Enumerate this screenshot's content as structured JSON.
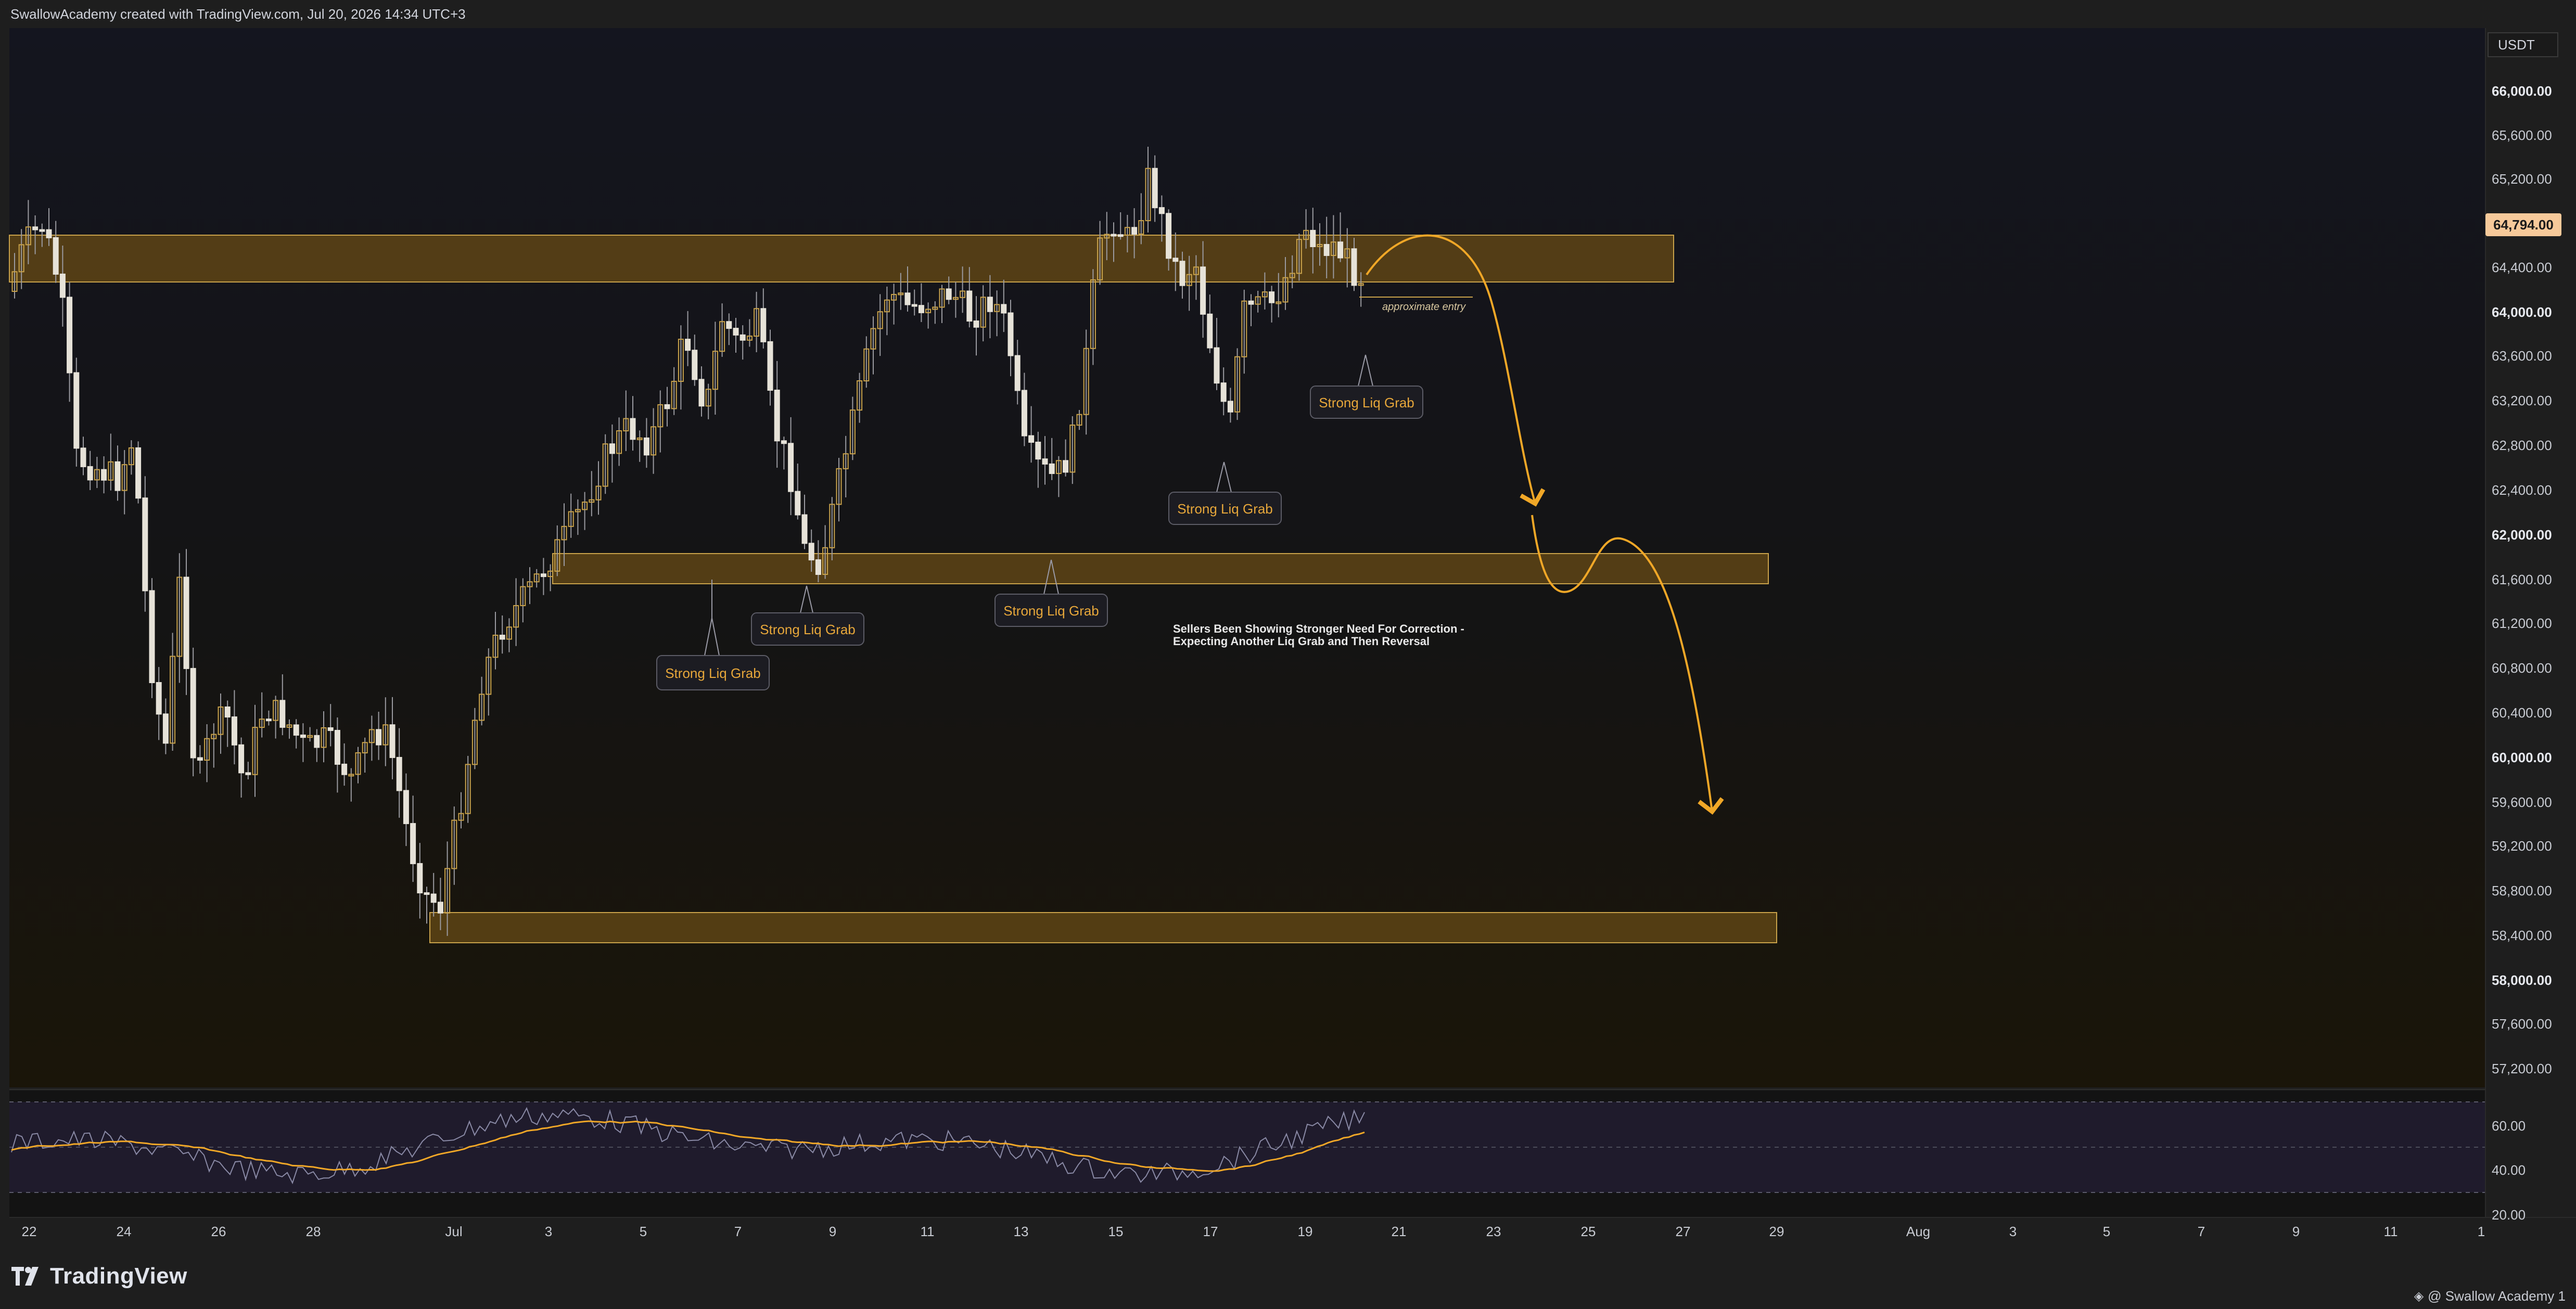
{
  "header": {
    "text": "SwallowAcademy created with TradingView.com, Jul 20, 2026 14:34 UTC+3"
  },
  "price_axis": {
    "currency": "USDT",
    "labels": [
      "66,000.00",
      "65,600.00",
      "65,200.00",
      "64,400.00",
      "64,000.00",
      "63,600.00",
      "63,200.00",
      "62,800.00",
      "62,400.00",
      "62,000.00",
      "61,600.00",
      "61,200.00",
      "60,800.00",
      "60,400.00",
      "60,000.00",
      "59,600.00",
      "59,200.00",
      "58,800.00",
      "58,400.00",
      "58,000.00",
      "57,600.00",
      "57,200.00"
    ],
    "bold_labels": [
      "66,000.00",
      "64,000.00",
      "62,000.00",
      "60,000.00",
      "58,000.00"
    ],
    "current_price": "64,794.00"
  },
  "time_axis": {
    "labels": [
      "22",
      "24",
      "26",
      "28",
      "Jul",
      "3",
      "5",
      "7",
      "9",
      "11",
      "13",
      "15",
      "17",
      "19",
      "21",
      "23",
      "25",
      "27",
      "29",
      "Aug",
      "3",
      "5",
      "7",
      "9",
      "11",
      "1"
    ]
  },
  "rsi_axis": {
    "labels": [
      "60.00",
      "40.00",
      "20.00"
    ]
  },
  "annotations": {
    "liq_grab_label": "Strong Liq Grab",
    "approximate_entry": "approximate entry",
    "note_line1": "Sellers Been Showing Stronger Need For Correction -",
    "note_line2": "Expecting Another Liq Grab and Then Reversal"
  },
  "branding": {
    "logo_text": "TradingView",
    "credit": "@ Swallow Academy 1"
  },
  "colors": {
    "zone_fill": "#5e4415",
    "zone_border": "#c9a24a",
    "arrow": "#f0a727",
    "bull_candle": "#c9a24a",
    "bear_candle": "#e6e2d8",
    "rsi_line": "#8a8aa6",
    "rsi_ma": "#f0a727",
    "price_tag": "#f6c99a"
  }
}
